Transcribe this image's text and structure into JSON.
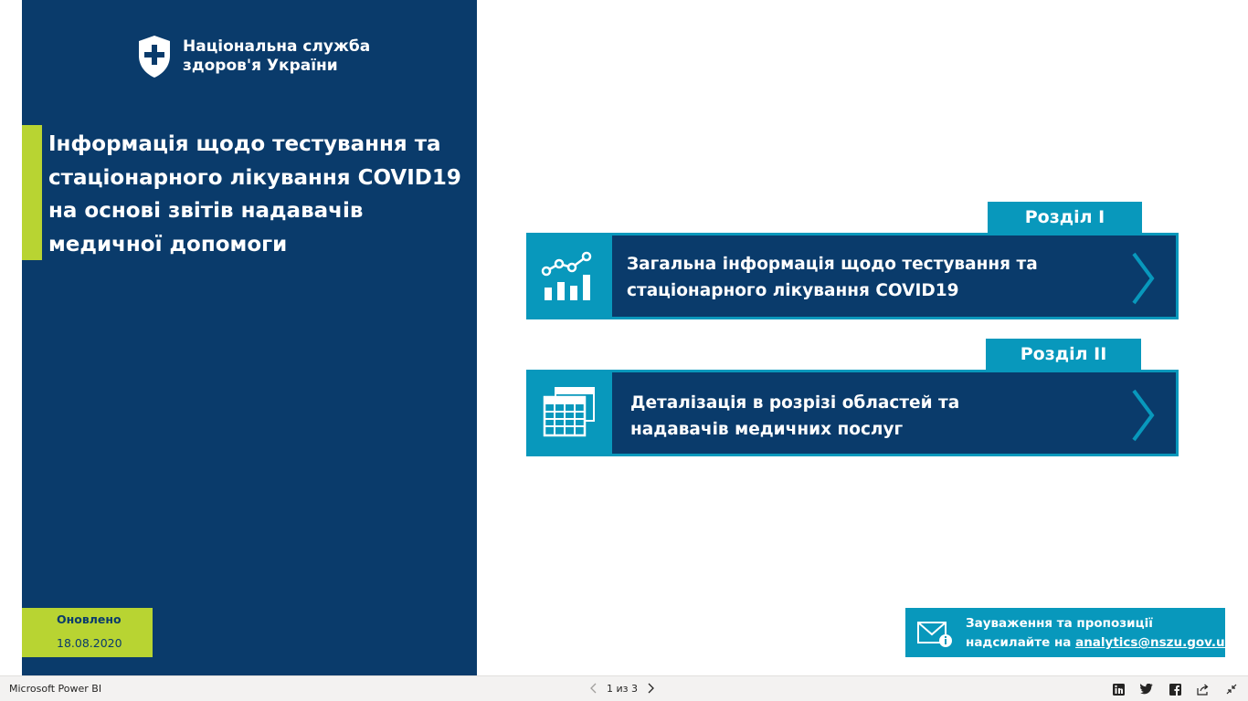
{
  "organization": {
    "name_line1": "Національна служба",
    "name_line2": "здоров'я України",
    "logo_icon": "shield-cross-icon"
  },
  "report": {
    "title": "Інформація щодо тестування та стаціонарного лікування COVID19 на основі звітів надавачів медичної допомоги",
    "updated_label": "Оновлено",
    "updated_date": "18.08.2020"
  },
  "sections": [
    {
      "tab_label": "Розділ I",
      "text_line1": "Загальна інформація щодо тестування та",
      "text_line2": "стаціонарного лікування COVID19",
      "icon": "chart-analytics-icon"
    },
    {
      "tab_label": "Розділ II",
      "text_line1": "Деталізація в розрізі областей та",
      "text_line2": "надавачів медичних послуг",
      "icon": "table-grid-icon"
    }
  ],
  "feedback": {
    "line1": "Зауваження та пропозиції",
    "line2_prefix": "надсилайте на ",
    "email": "analytics@nszu.gov.ua",
    "icon": "mail-info-icon"
  },
  "footer": {
    "app_name": "Microsoft Power BI",
    "page_indicator": "1 из 3"
  },
  "colors": {
    "navy": "#0a3b6b",
    "teal": "#0898bc",
    "lime": "#b8d432"
  }
}
